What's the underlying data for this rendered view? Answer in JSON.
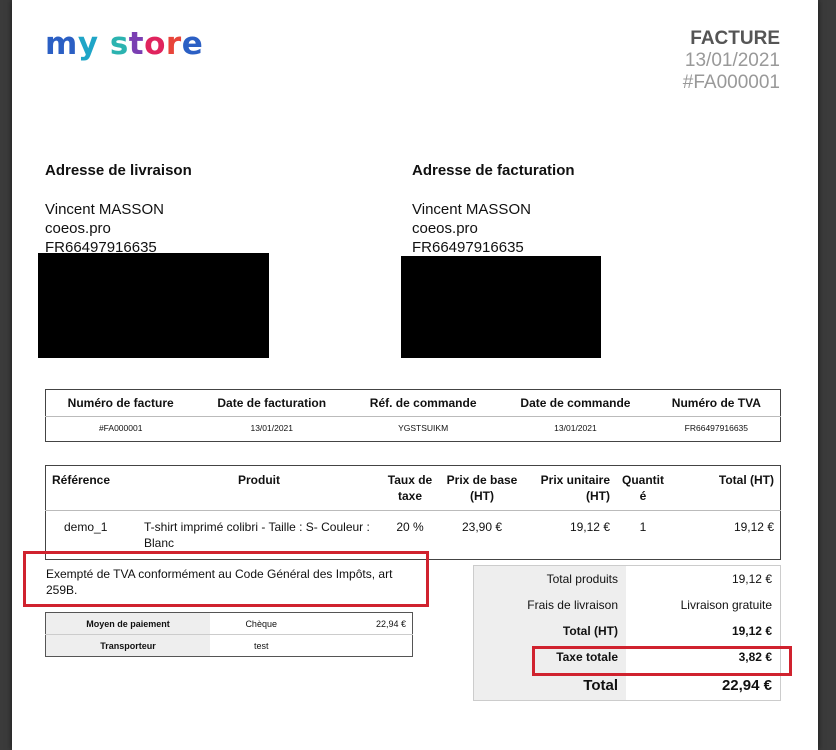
{
  "logo": {
    "text": "my store",
    "letters": [
      "m",
      "y",
      " ",
      "s",
      "t",
      "o",
      "r",
      "e"
    ],
    "colors": [
      "#2b5fc4",
      "#1fa5c7",
      "#ffffff",
      "#2bb3b0",
      "#7a3fb2",
      "#e0245e",
      "#e8443a",
      "#2b5fc4"
    ]
  },
  "header": {
    "title": "FACTURE",
    "date": "13/01/2021",
    "number": "#FA000001"
  },
  "shipping": {
    "heading": "Adresse de livraison",
    "name": "Vincent MASSON",
    "company": "coeos.pro",
    "vat": "FR66497916635"
  },
  "billing": {
    "heading": "Adresse de facturation",
    "name": "Vincent MASSON",
    "company": "coeos.pro",
    "vat": "FR66497916635"
  },
  "info_table": {
    "headers": [
      "Numéro de facture",
      "Date de facturation",
      "Réf. de commande",
      "Date de commande",
      "Numéro de TVA"
    ],
    "values": [
      "#FA000001",
      "13/01/2021",
      "YGSTSUIKM",
      "13/01/2021",
      "FR66497916635"
    ]
  },
  "product_table": {
    "headers": [
      "Référence",
      "Produit",
      "Taux de taxe",
      "Prix de base (HT)",
      "Prix unitaire (HT)",
      "Quantité",
      "Total (HT)"
    ],
    "rows": [
      [
        "demo_1",
        "T-shirt imprimé colibri - Taille : S- Couleur : Blanc",
        "20 %",
        "23,90 €",
        "19,12 €",
        "1",
        "19,12 €"
      ]
    ]
  },
  "tax_note": "Exempté de TVA conformément au Code Général des Impôts, art 259B.",
  "payment": {
    "method_label": "Moyen de paiement",
    "method": "Chèque",
    "amount": "22,94 €",
    "carrier_label": "Transporteur",
    "carrier": "test"
  },
  "totals": {
    "products_label": "Total produits",
    "products": "19,12 €",
    "shipping_label": "Frais de livraison",
    "shipping": "Livraison gratuite",
    "ht_label": "Total (HT)",
    "ht": "19,12 €",
    "tax_label": "Taxe totale",
    "tax": "3,82 €",
    "total_label": "Total",
    "total": "22,94 €"
  }
}
